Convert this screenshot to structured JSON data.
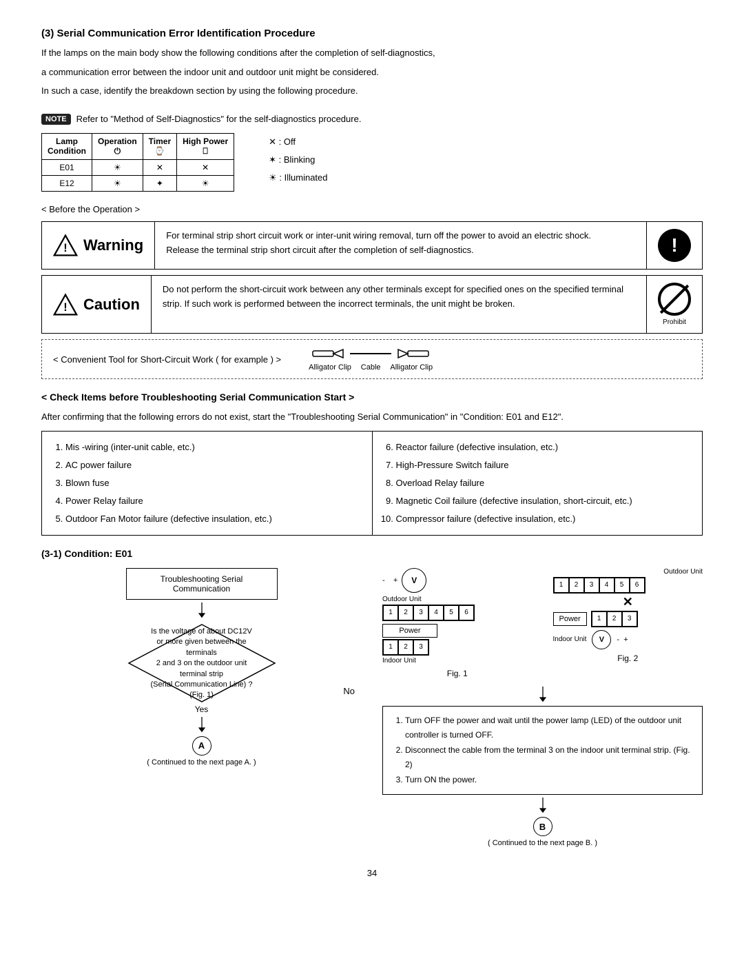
{
  "title": "(3) Serial Communication Error Identification Procedure",
  "intro": [
    "If the lamps on the main body show the following conditions after the completion of self-diagnostics,",
    "a communication error between the indoor unit and outdoor unit might be considered.",
    "In such a case, identify the breakdown section by using the following procedure."
  ],
  "note": "Refer to \"Method of Self-Diagnostics\" for the self-diagnostics procedure.",
  "table": {
    "headers": [
      "Lamp",
      "Operation",
      "Timer",
      "High Power"
    ],
    "rows": [
      {
        "condition": "E01",
        "op": "☀",
        "timer": "✕",
        "hp": "✕"
      },
      {
        "condition": "E12",
        "op": "☀",
        "timer": "✶",
        "hp": "☀"
      }
    ]
  },
  "legend": {
    "off": "✕ : Off",
    "blinking": "✶ : Blinking",
    "illuminated": "☀ : Illuminated"
  },
  "before_operation": "< Before the Operation >",
  "warning": {
    "label": "Warning",
    "text": "For terminal strip short circuit work or inter-unit wiring removal, turn off the power to avoid an electric shock.\nRelease the terminal strip short circuit after the completion of self-diagnostics."
  },
  "caution": {
    "label": "Caution",
    "text": "Do not perform the short-circuit work between any other terminals except for specified ones on the specified terminal strip. If such work is performed between the incorrect terminals, the unit might be broken."
  },
  "prohibit_label": "Prohibit",
  "tool_box": "< Convenient Tool for Short-Circuit Work ( for example ) >",
  "cable_labels": [
    "Alligator Clip",
    "Cable",
    "Alligator Clip"
  ],
  "check_items_title": "< Check Items before Troubleshooting Serial Communication Start >",
  "check_intro": "After confirming that the following errors do not exist, start the \"Troubleshooting Serial Communication\" in \"Condition: E01 and E12\".",
  "list_col1": [
    "Mis -wiring (inter-unit cable, etc.)",
    "AC power failure",
    "Blown fuse",
    "Power Relay failure",
    "Outdoor Fan Motor failure (defective insulation, etc.)"
  ],
  "list_col2": [
    "Reactor failure (defective insulation, etc.)",
    "High-Pressure Switch failure",
    "Overload Relay failure",
    "Magnetic Coil failure (defective insulation, short-circuit, etc.)",
    "Compressor failure (defective insulation, etc.)"
  ],
  "condition_title": "(3-1) Condition: E01",
  "flowchart": {
    "start_label": "Troubleshooting Serial Communication",
    "diamond_text": "Is the voltage of about DC12V\nor more given between the terminals\n2 and 3 on the outdoor unit terminal strip\n(Serial Communication Line) ?\n(Fig. 1)",
    "no_label": "No",
    "yes_label": "Yes",
    "node_a": "A",
    "node_b": "B",
    "continued_a": "( Continued to the next page A. )",
    "continued_b": "( Continued to the next page B. )"
  },
  "fig1_label": "Fig. 1",
  "fig2_label": "Fig. 2",
  "outdoor_unit_label": "Outdoor Unit",
  "indoor_unit_label": "Indoor Unit",
  "power_label": "Power",
  "fig1_terminals": [
    "1",
    "2",
    "3",
    "4",
    "5",
    "6"
  ],
  "fig1_indoor": [
    "1",
    "2",
    "3"
  ],
  "fig2_terminals_outdoor": [
    "1",
    "2",
    "3",
    "4",
    "5",
    "6"
  ],
  "fig2_terminals_indoor": [
    "1",
    "2",
    "3"
  ],
  "instructions": [
    "Turn OFF the power and wait until the power lamp (LED) of the outdoor unit controller is turned OFF.",
    "Disconnect the cable from the terminal 3 on the indoor unit terminal strip.  (Fig. 2)",
    "Turn ON the power."
  ],
  "page_number": "34"
}
